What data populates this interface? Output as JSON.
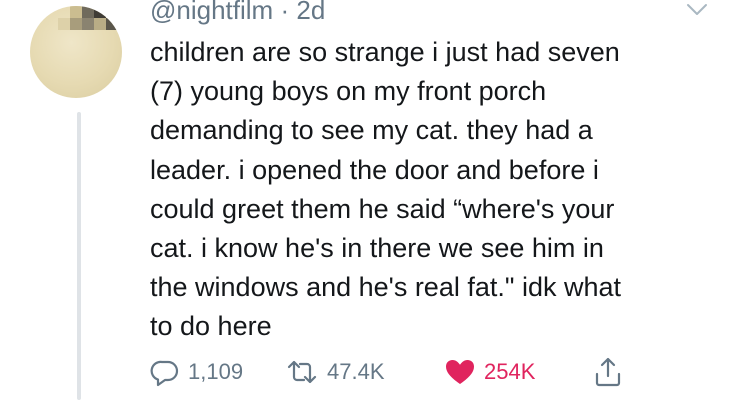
{
  "tweet": {
    "handle": "@nightfilm",
    "separator": "·",
    "age": "2d",
    "text_lines": [
      "children are so strange i just had seven",
      "(7) young boys on my front porch",
      "demanding to see my cat. they had a",
      "leader. i opened the door and before i",
      "could greet them he said “where's your",
      "cat. i know he's in there we see him in",
      "the windows and he's real fat.\" idk what",
      "to do here"
    ]
  },
  "actions": {
    "reply": {
      "icon": "reply-icon",
      "count": "1,109"
    },
    "retweet": {
      "icon": "retweet-icon",
      "count": "47.4K"
    },
    "like": {
      "icon": "heart-icon",
      "count": "254K",
      "liked": true,
      "color": "#e0245e"
    },
    "share": {
      "icon": "share-icon"
    }
  },
  "colors": {
    "text": "#14171a",
    "secondary": "#657786",
    "like": "#e0245e",
    "thread_line": "#dfe3e7"
  }
}
